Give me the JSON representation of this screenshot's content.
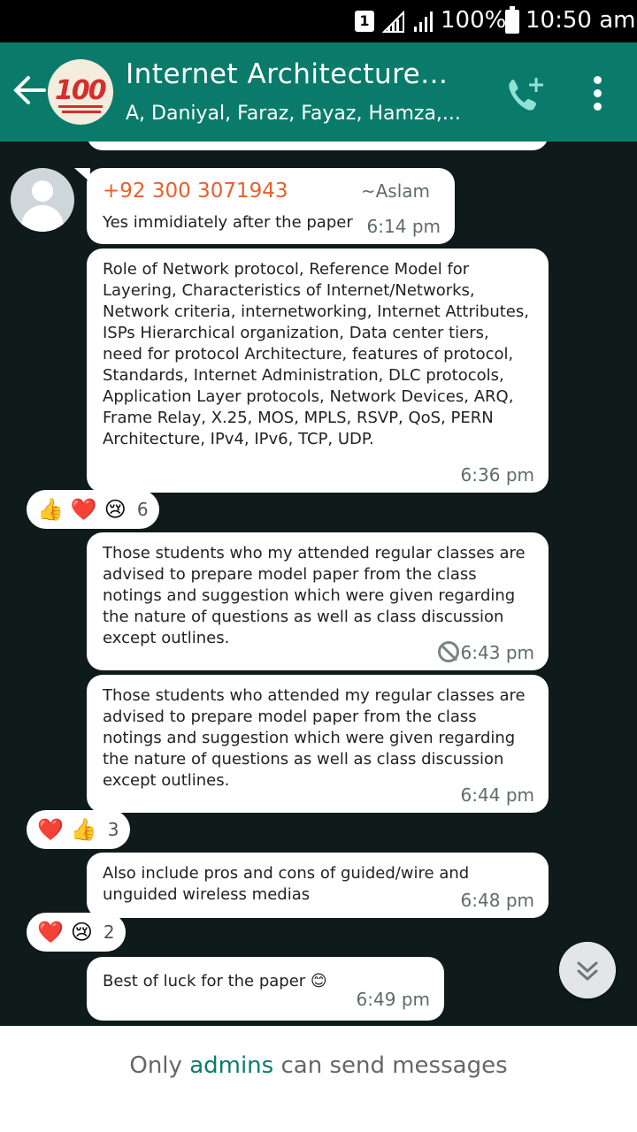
{
  "status_bar": {
    "sim": "1",
    "battery": "100%",
    "time": "10:50 am"
  },
  "header": {
    "title": "Internet Architecture...",
    "subtitle": "A, Daniyal, Faraz, Fayaz, Hamza,...",
    "avatar_emoji": "100"
  },
  "messages": [
    {
      "sender_phone": "+92 300 3071943",
      "sender_name": "~Aslam",
      "text": "Yes immidiately after the paper",
      "time": "6:14 pm"
    },
    {
      "text": "Role of Network protocol, Reference Model for Layering, Characteristics of Internet/Networks, Network criteria, internetworking, Internet Attributes, ISPs Hierarchical organization, Data center tiers, need for protocol Architecture, features of protocol, Standards, Internet Administration, DLC protocols, Application Layer protocols, Network Devices, ARQ, Frame Relay, X.25, MOS, MPLS, RSVP, QoS, PERN Architecture, IPv4, IPv6, TCP, UDP.",
      "time": "6:36 pm",
      "reactions": [
        "👍",
        "❤️",
        "😢"
      ],
      "reaction_count": "6"
    },
    {
      "text": "Those students who my attended regular classes are advised to prepare model paper from the class notings and suggestion which were given regarding the nature of questions as well as class discussion except outlines.",
      "time": "6:43 pm"
    },
    {
      "text": "Those students who attended my regular classes are advised to prepare model paper from the class notings and suggestion which were given regarding the nature of questions as well as class discussion except outlines.",
      "time": "6:44 pm",
      "reactions": [
        "❤️",
        "👍"
      ],
      "reaction_count": "3"
    },
    {
      "text": "Also include pros and cons of guided/wire and unguided wireless medias",
      "time": "6:48 pm",
      "reactions": [
        "❤️",
        "😢"
      ],
      "reaction_count": "2"
    },
    {
      "text": "Best of luck for the paper 😊",
      "time": "6:49 pm"
    }
  ],
  "footer": {
    "prefix": "Only ",
    "admins": "admins",
    "suffix": " can send messages"
  },
  "colors": {
    "header": "#0a7b6b",
    "sender": "#e8602c",
    "background": "#0f1a1a"
  }
}
